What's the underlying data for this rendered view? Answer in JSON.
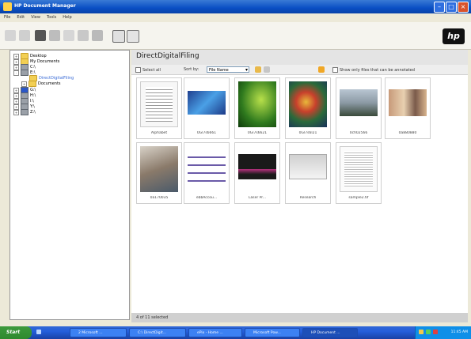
{
  "window": {
    "title": "HP Document Manager"
  },
  "menubar": [
    "File",
    "Edit",
    "View",
    "Tools",
    "Help"
  ],
  "toolbar": {
    "icons": [
      "scan-icon",
      "copy-icon",
      "undo-icon",
      "print-icon",
      "email-icon",
      "phone-icon",
      "fax-icon",
      "calendar-icon",
      "link-icon"
    ],
    "brand": "hp"
  },
  "tree": {
    "items": [
      {
        "label": "Desktop",
        "expander": "+",
        "icon": "folder-icon"
      },
      {
        "label": "My Documents",
        "expander": "+",
        "icon": "folder-icon"
      },
      {
        "label": "C:\\",
        "expander": "+",
        "icon": "drive-icon"
      },
      {
        "label": "E:\\",
        "expander": "-",
        "icon": "drive-icon"
      },
      {
        "label": "DirectDigitalFiling",
        "expander": "",
        "icon": "folder-icon",
        "selected": true
      },
      {
        "label": "Documents",
        "expander": "+",
        "icon": "folder-icon"
      },
      {
        "label": "G:\\",
        "expander": "+",
        "icon": "drive-icon"
      },
      {
        "label": "H:\\",
        "expander": "+",
        "icon": "drive-icon"
      },
      {
        "label": "I:\\",
        "expander": "+",
        "icon": "drive-icon"
      },
      {
        "label": "Y:\\",
        "expander": "+",
        "icon": "drive-icon"
      },
      {
        "label": "Z:\\",
        "expander": "+",
        "icon": "drive-icon"
      }
    ]
  },
  "main": {
    "title": "DirectDigitalFiling",
    "select_all": "Select all",
    "sort_by": "Sort by:",
    "sort_value": "File Name",
    "show_only": "Show only files that can be annotated",
    "thumbnails": [
      {
        "caption": "Alphabet"
      },
      {
        "caption": "0Gl7s6661"
      },
      {
        "caption": "0Gl7s6621"
      },
      {
        "caption": "0Gl7s6l21"
      },
      {
        "caption": "0ch02566"
      },
      {
        "caption": "0a880880"
      },
      {
        "caption": "0a170035"
      },
      {
        "caption": "ebbAccou..."
      },
      {
        "caption": "Laser Pr..."
      },
      {
        "caption": "Research"
      },
      {
        "caption": "sample2.tif"
      }
    ],
    "status": "4 of 11 selected"
  },
  "taskbar": {
    "start": "Start",
    "buttons": [
      "2 Microsoft ...",
      "C:\\ DirectDigit...",
      "ePix - Home ...",
      "Microsoft Pow...",
      "HP Document ..."
    ],
    "clock": "11:45 AM"
  },
  "colors": {
    "title_bar": "#0a4fc4",
    "taskbar": "#245edb",
    "start": "#2f8a2f"
  }
}
